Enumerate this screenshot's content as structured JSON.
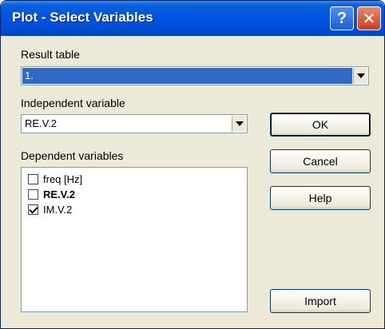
{
  "window": {
    "title": "Plot - Select Variables"
  },
  "titlebar": {
    "help_glyph": "?",
    "close_glyph": "✕"
  },
  "result_table": {
    "label": "Result table",
    "value": "1."
  },
  "independent": {
    "label": "Independent variable",
    "value": "RE.V.2"
  },
  "dependent": {
    "label": "Dependent variables",
    "items": [
      {
        "label": "freq [Hz]",
        "checked": false,
        "bold": false
      },
      {
        "label": "RE.V.2",
        "checked": false,
        "bold": true
      },
      {
        "label": "IM.V.2",
        "checked": true,
        "bold": false
      }
    ]
  },
  "buttons": {
    "ok": "OK",
    "cancel": "Cancel",
    "help": "Help",
    "import": "Import"
  },
  "colors": {
    "title_bar": "#0054e3",
    "selection": "#316ac5",
    "dialog_bg": "#ece9d8"
  }
}
